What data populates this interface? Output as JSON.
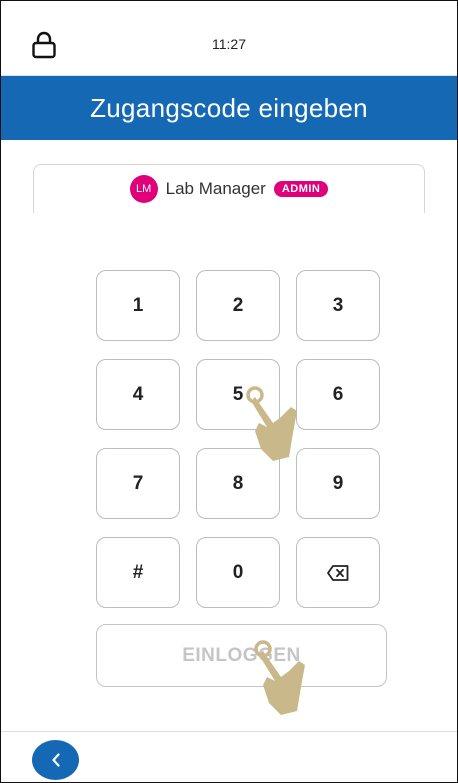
{
  "status_bar": {
    "time": "11:27",
    "lock_icon": "lock-icon"
  },
  "header": {
    "title": "Zugangscode eingeben"
  },
  "user": {
    "initials": "LM",
    "name": "Lab Manager",
    "role": "ADMIN"
  },
  "keypad": {
    "keys": [
      "1",
      "2",
      "3",
      "4",
      "5",
      "6",
      "7",
      "8",
      "9",
      "#",
      "0"
    ],
    "backspace_icon": "backspace-icon"
  },
  "login": {
    "label": "EINLOGGEN"
  },
  "footer": {
    "back_icon": "chevron-left-icon"
  },
  "colors": {
    "primary": "#1468b4",
    "accent": "#e0007a",
    "disabled_text": "#c5c5c5",
    "hand": "#c9b88a"
  }
}
